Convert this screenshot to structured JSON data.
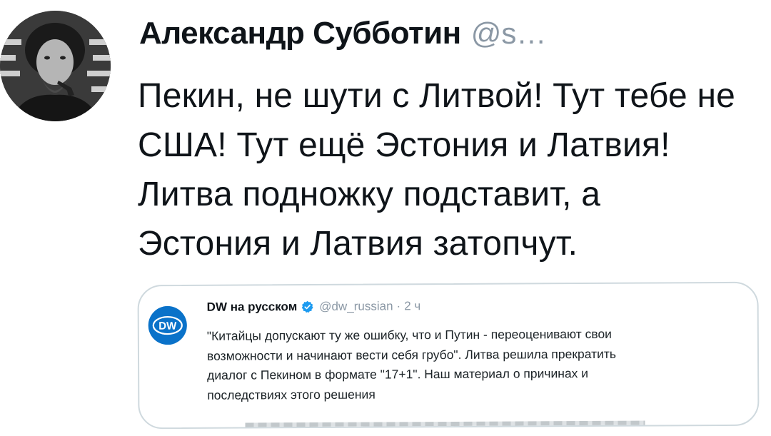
{
  "tweet": {
    "author_name": "Александр Субботин",
    "author_handle": "@s…",
    "avatar_icon": "user-avatar-photo",
    "text_lines": [
      "Пекин, не шути с Литвой! Тут тебе не",
      "США! Тут ещё Эстония и Латвия!",
      "Литва подножку подставит, а",
      "Эстония и Латвия затопчут."
    ]
  },
  "quoted_tweet": {
    "logo_icon": "dw-logo-icon",
    "logo_text": "DW",
    "author_name": "DW на русском",
    "verified_icon": "verified-badge-icon",
    "handle": "@dw_russian",
    "separator": "·",
    "time": "2 ч",
    "text_lines": [
      "\"Китайцы допускают ту же ошибку, что и Путин - переоценивают свои",
      "возможности и начинают вести себя грубо\". Литва решила прекратить",
      "диалог с Пекином в формате \"17+1\". Наш материал о причинах и",
      "последствиях этого решения"
    ]
  },
  "colors": {
    "text": "#0f1419",
    "muted": "#8b98a5",
    "border": "#cfd9de",
    "dw_blue": "#0a72c9",
    "verified_blue": "#1d9bf0"
  }
}
